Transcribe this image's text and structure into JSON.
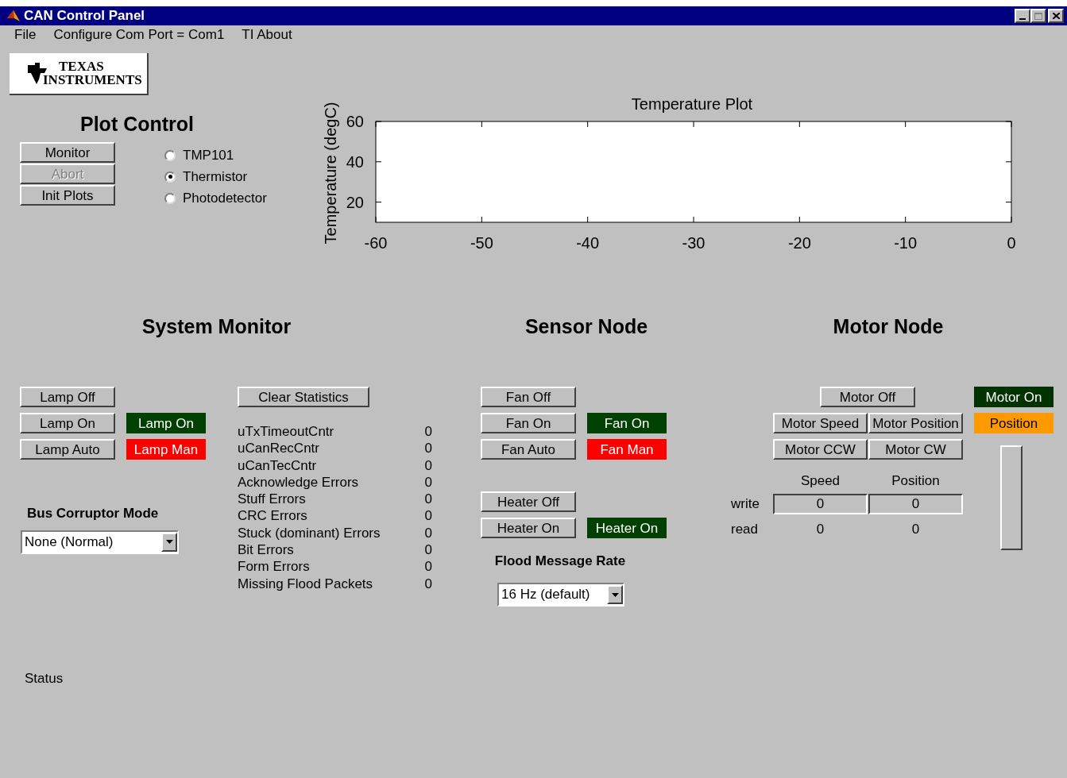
{
  "window": {
    "title": "CAN Control Panel"
  },
  "menu": [
    "File",
    "Configure Com Port = Com1",
    "TI About"
  ],
  "logo": {
    "line_1": "TEXAS",
    "line_2": "INSTRUMENTS"
  },
  "plot_control": {
    "title": "Plot Control",
    "buttons": [
      {
        "label": "Monitor",
        "disabled": false
      },
      {
        "label": "Abort",
        "disabled": true
      },
      {
        "label": "Init Plots",
        "disabled": false
      }
    ],
    "sources": [
      {
        "label": "TMP101",
        "selected": false
      },
      {
        "label": "Thermistor",
        "selected": true
      },
      {
        "label": "Photodetector",
        "selected": false
      }
    ]
  },
  "plot": {
    "chart_data": {
      "type": "line",
      "title": "Temperature Plot",
      "ylabel": "Temperature (degC)",
      "xlim": [
        -60,
        0
      ],
      "ylim": [
        10,
        60
      ],
      "xticks": [
        -60,
        -50,
        -40,
        -30,
        -20,
        -10,
        0
      ],
      "yticks": [
        20,
        40,
        60
      ]
    }
  },
  "system_monitor": {
    "title": "System Monitor",
    "lamp_rows": [
      {
        "button": "Lamp Off"
      },
      {
        "button": "Lamp On",
        "indicator": {
          "label": "Lamp On",
          "color": "#004000"
        }
      },
      {
        "button": "Lamp Auto",
        "indicator": {
          "label": "Lamp Man",
          "color": "#ff0000"
        }
      }
    ],
    "bus_corruptor": {
      "label": "Bus Corruptor Mode",
      "value": "None (Normal)"
    },
    "clear_button": "Clear Statistics",
    "stats": [
      {
        "name": "uTxTimeoutCntr",
        "value": "0"
      },
      {
        "name": "uCanRecCntr",
        "value": "0"
      },
      {
        "name": "uCanTecCntr",
        "value": "0"
      },
      {
        "name": "Acknowledge Errors",
        "value": "0"
      },
      {
        "name": "Stuff Errors",
        "value": "0"
      },
      {
        "name": "CRC Errors",
        "value": "0"
      },
      {
        "name": "Stuck (dominant) Errors",
        "value": "0"
      },
      {
        "name": "Bit Errors",
        "value": "0"
      },
      {
        "name": "Form Errors",
        "value": "0"
      },
      {
        "name": "Missing Flood Packets",
        "value": "0"
      }
    ]
  },
  "sensor_node": {
    "title": "Sensor Node",
    "fan_rows": [
      {
        "button": "Fan Off"
      },
      {
        "button": "Fan On",
        "indicator": {
          "label": "Fan On",
          "color": "#004000"
        }
      },
      {
        "button": "Fan Auto",
        "indicator": {
          "label": "Fan Man",
          "color": "#ff0000"
        }
      }
    ],
    "heater_rows": [
      {
        "button": "Heater Off"
      },
      {
        "button": "Heater On",
        "indicator": {
          "label": "Heater On",
          "color": "#004000"
        }
      }
    ],
    "flood_rate": {
      "label": "Flood Message Rate",
      "value": "16 Hz (default)"
    }
  },
  "motor_node": {
    "title": "Motor Node",
    "off_button": "Motor Off",
    "mode_buttons": [
      "Motor Speed",
      "Motor Position"
    ],
    "direction_buttons": [
      "Motor CCW",
      "Motor CW"
    ],
    "columns": [
      "Speed",
      "Position"
    ],
    "write_label": "write",
    "write_values": [
      "0",
      "0"
    ],
    "read_label": "read",
    "read_values": [
      "0",
      "0"
    ],
    "indicators": [
      {
        "label": "Motor On",
        "color": "#003300"
      },
      {
        "label": "Position",
        "color": "#ff9900"
      }
    ],
    "position_gauge": {
      "level": 0
    }
  },
  "status": "Status"
}
